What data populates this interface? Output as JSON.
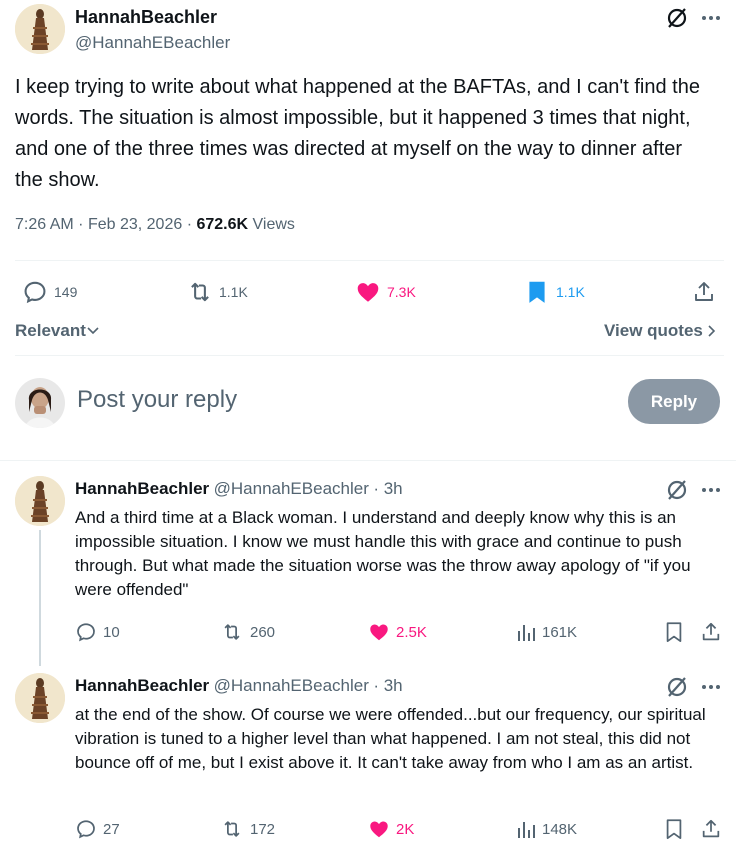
{
  "colors": {
    "pink": "#f91880",
    "blue": "#1d9bf0",
    "gray": "#536471",
    "reply_button": "#8b98a5"
  },
  "main_post": {
    "display_name": "HannahBeachler",
    "handle": "@HannahEBeachler",
    "text": "I keep trying to write about what happened at the BAFTAs, and I can't find the words.  The situation is almost impossible, but it happened 3 times that night, and one of the three times was directed at myself on the way to dinner after the show.",
    "time": "7:26 AM",
    "date": "Feb 23, 2026",
    "views_count": "672.6K",
    "views_label": "Views",
    "stats": {
      "replies": "149",
      "reposts": "1.1K",
      "likes": "7.3K",
      "bookmarks": "1.1K"
    },
    "icons": [
      "grok-icon",
      "more-icon",
      "reply-icon",
      "repost-icon",
      "like-icon",
      "bookmark-icon",
      "share-icon"
    ]
  },
  "sort": {
    "label": "Relevant",
    "view_quotes": "View quotes"
  },
  "composer": {
    "placeholder": "Post your reply",
    "button": "Reply"
  },
  "replies": [
    {
      "display_name": "HannahBeachler",
      "handle": "@HannahEBeachler",
      "time": "3h",
      "text": "And a third time at a Black woman.  I understand and deeply know why this is an impossible situation.  I know we must handle this with grace and continue to push through.  But what made the situation worse was the throw away apology of \"if you were offended\"",
      "stats": {
        "replies": "10",
        "reposts": "260",
        "likes": "2.5K",
        "views": "161K"
      }
    },
    {
      "display_name": "HannahBeachler",
      "handle": "@HannahEBeachler",
      "time": "3h",
      "text": "at the end of the show.  Of course we were offended...but our frequency, our spiritual vibration is tuned to a higher level than what happened.  I am not steal, this did not bounce off of me, but I exist above it. It can't take away from who I am as an artist.",
      "stats": {
        "replies": "27",
        "reposts": "172",
        "likes": "2K",
        "views": "148K"
      }
    }
  ]
}
